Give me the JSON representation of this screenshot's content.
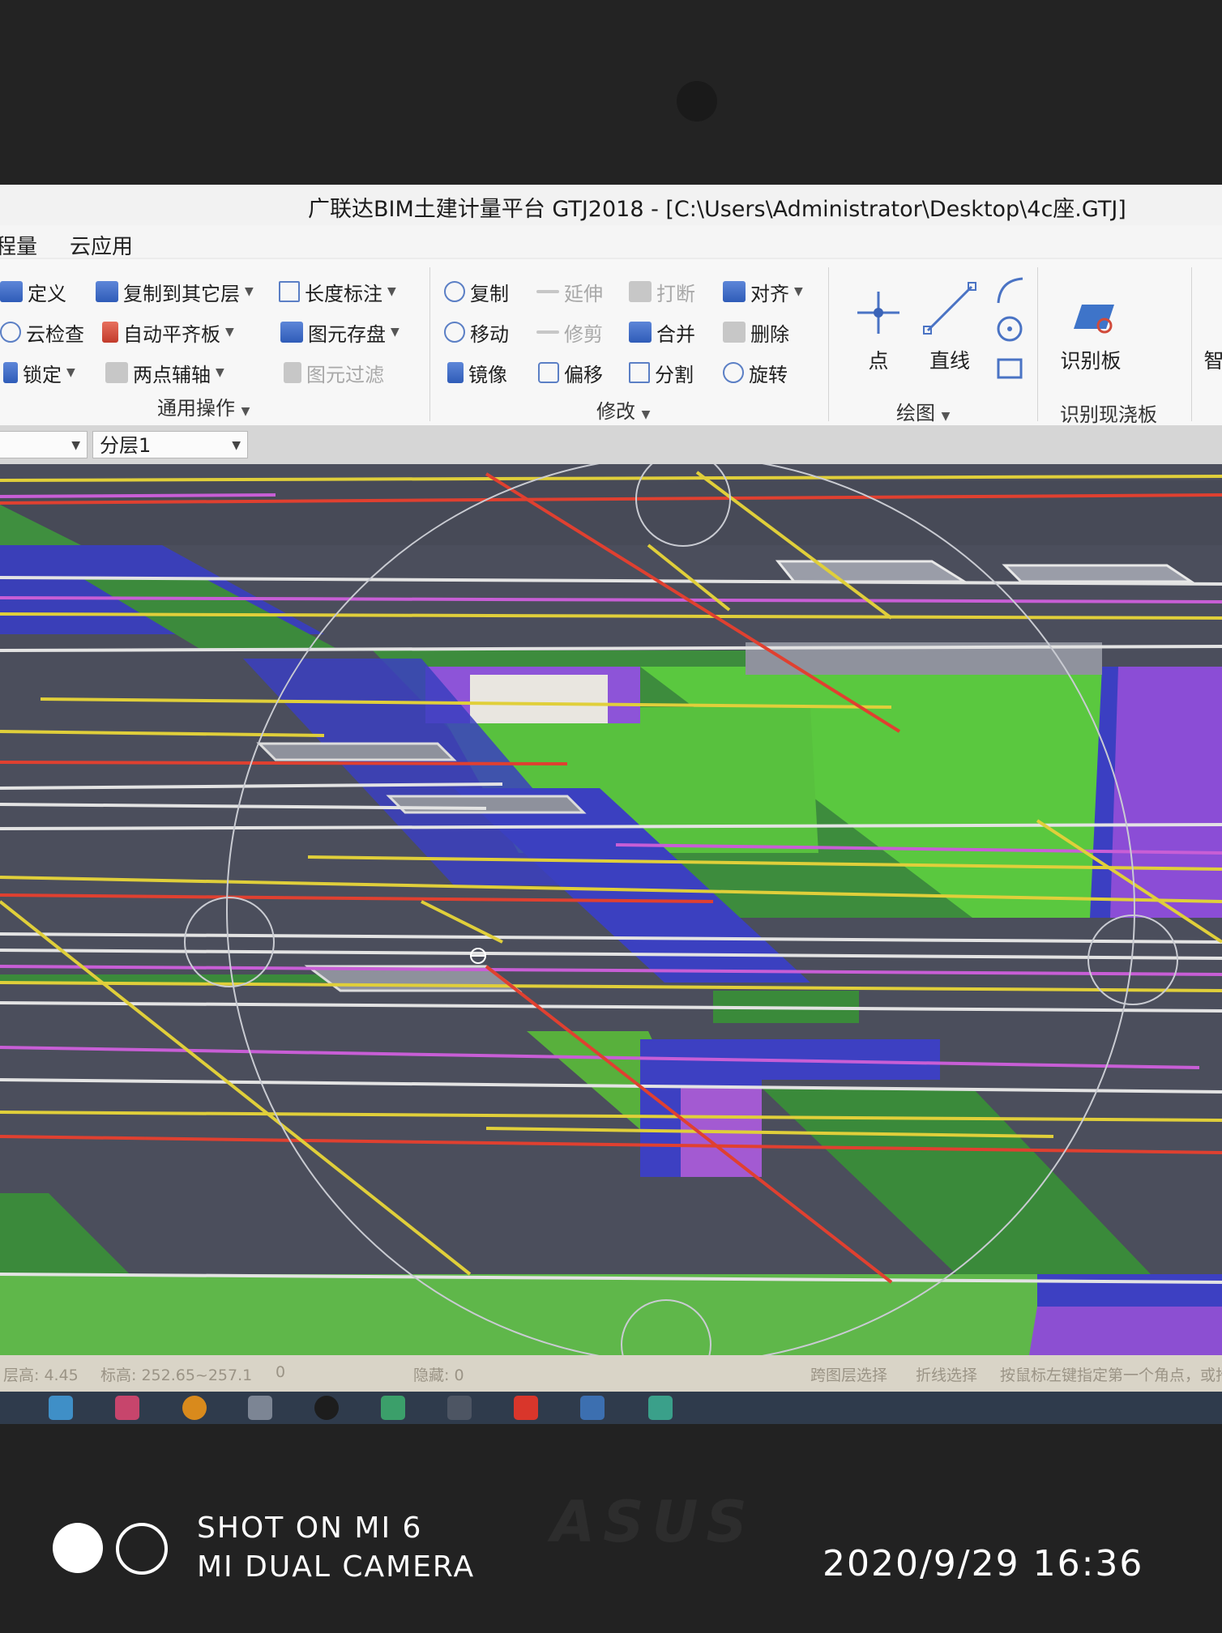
{
  "window": {
    "title": "广联达BIM土建计量平台 GTJ2018 - [C:\\Users\\Administrator\\Desktop\\4c座.GTJ]"
  },
  "menu": {
    "items": [
      "程量",
      "云应用"
    ]
  },
  "ribbon": {
    "general": {
      "label": "通用操作",
      "buttons": [
        "定义",
        "复制到其它层",
        "长度标注",
        "云检查",
        "自动平齐板",
        "图元存盘",
        "锁定",
        "两点辅轴",
        "图元过滤"
      ]
    },
    "modify": {
      "label": "修改",
      "buttons": [
        "复制",
        "延伸",
        "打断",
        "对齐",
        "移动",
        "修剪",
        "合并",
        "删除",
        "镜像",
        "偏移",
        "分割",
        "旋转"
      ]
    },
    "draw": {
      "label": "绘图",
      "buttons": [
        "点",
        "直线"
      ]
    },
    "recognize": {
      "label": "识别现浇板",
      "buttons": [
        "识别板"
      ]
    },
    "cut_off": "智"
  },
  "layer_bar": {
    "floor_selector": "",
    "layer_selector": "分层1"
  },
  "status_bar": {
    "items": [
      "层高: 4.45",
      "标高: 252.65~257.1",
      "0",
      "隐藏: 0",
      "跨图层选择",
      "折线选择",
      "按鼠标左键指定第一个角点，或拾取构件图元"
    ]
  },
  "camera_watermark": {
    "line1": "SHOT ON MI 6",
    "line2": "MI DUAL CAMERA",
    "timestamp": "2020/9/29  16:36"
  },
  "laptop_brand": "ASUS"
}
